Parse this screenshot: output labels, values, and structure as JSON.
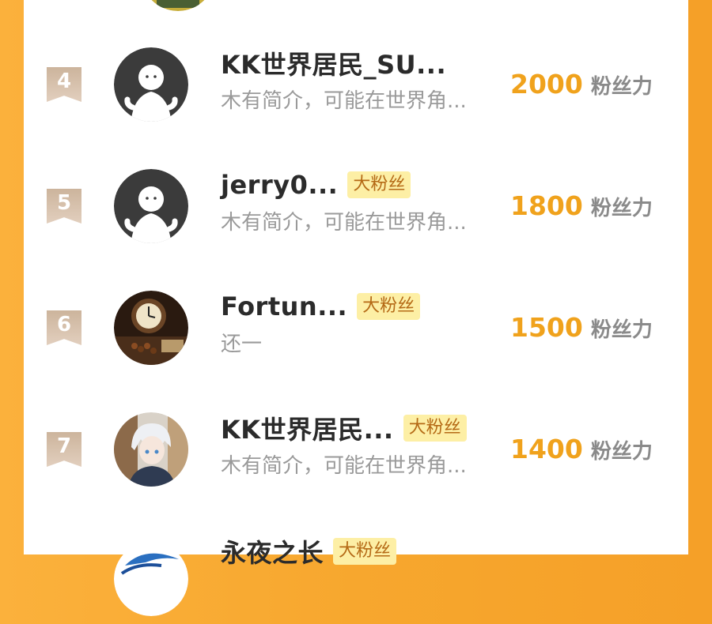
{
  "leaderboard": {
    "rows": [
      {
        "rank": "4",
        "name": "KK世界居民_SU...",
        "badge": "",
        "bio": "木有简介，可能在世界角...",
        "score": "2000",
        "unit": "粉丝力",
        "avatar": "default-avatar"
      },
      {
        "rank": "5",
        "name": "jerry0...",
        "badge": "大粉丝",
        "bio": "木有简介，可能在世界角...",
        "score": "1800",
        "unit": "粉丝力",
        "avatar": "default-avatar"
      },
      {
        "rank": "6",
        "name": "Fortun...",
        "badge": "大粉丝",
        "bio": "还一",
        "score": "1500",
        "unit": "粉丝力",
        "avatar": "clock-photo-avatar"
      },
      {
        "rank": "7",
        "name": "KK世界居民...",
        "badge": "大粉丝",
        "bio": "木有简介，可能在世界角...",
        "score": "1400",
        "unit": "粉丝力",
        "avatar": "anime-character-avatar"
      },
      {
        "rank": "",
        "name": "永夜之长",
        "badge": "大粉丝",
        "bio": "",
        "score": "",
        "unit": "",
        "avatar": "blue-globe-avatar"
      }
    ]
  },
  "colors": {
    "background_orange": "#f7a72e",
    "score": "#f0a21c",
    "badge_bg": "#fdefa5",
    "badge_text": "#b56a16",
    "rank_badge": "#d4bda6"
  }
}
